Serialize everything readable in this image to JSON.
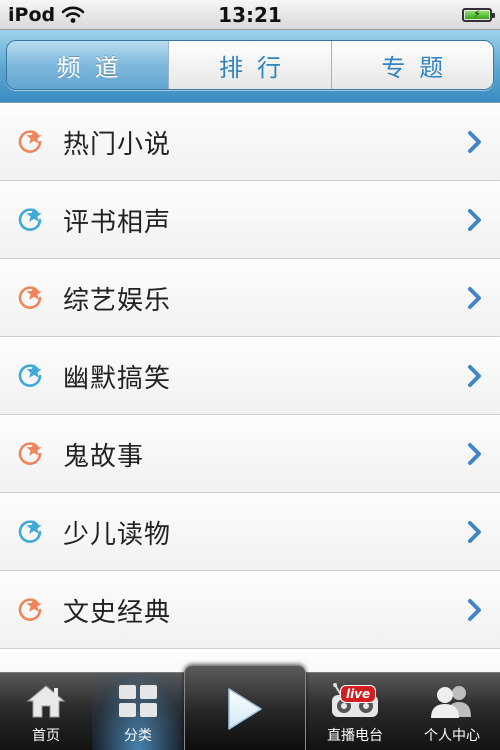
{
  "status_bar": {
    "carrier": "iPod",
    "time": "13:21",
    "icons": {
      "wifi": "wifi-icon",
      "battery": "battery-icon"
    }
  },
  "tabs": [
    {
      "label": "频道",
      "active": true
    },
    {
      "label": "排行",
      "active": false
    },
    {
      "label": "专题",
      "active": false
    }
  ],
  "categories": [
    {
      "label": "热门小说",
      "icon": "star-refresh-orange-icon",
      "color": "#f0855a"
    },
    {
      "label": "评书相声",
      "icon": "star-refresh-blue-icon",
      "color": "#3ea8d8"
    },
    {
      "label": "综艺娱乐",
      "icon": "star-refresh-orange-icon",
      "color": "#f0855a"
    },
    {
      "label": "幽默搞笑",
      "icon": "star-refresh-blue-icon",
      "color": "#3ea8d8"
    },
    {
      "label": "鬼故事",
      "icon": "star-refresh-orange-icon",
      "color": "#f0855a"
    },
    {
      "label": "少儿读物",
      "icon": "star-refresh-blue-icon",
      "color": "#3ea8d8"
    },
    {
      "label": "文史经典",
      "icon": "star-refresh-orange-icon",
      "color": "#f0855a"
    }
  ],
  "tab_bar": {
    "home": {
      "label": "首页",
      "icon": "home-icon"
    },
    "category": {
      "label": "分类",
      "icon": "grid-icon",
      "selected": true
    },
    "play": {
      "icon": "play-icon"
    },
    "radio": {
      "label": "直播电台",
      "icon": "radio-icon",
      "badge": "live"
    },
    "profile": {
      "label": "个人中心",
      "icon": "users-icon"
    }
  },
  "colors": {
    "accent": "#2f84c1",
    "header": "#5aa6d2",
    "chevron": "#3f86c2"
  }
}
